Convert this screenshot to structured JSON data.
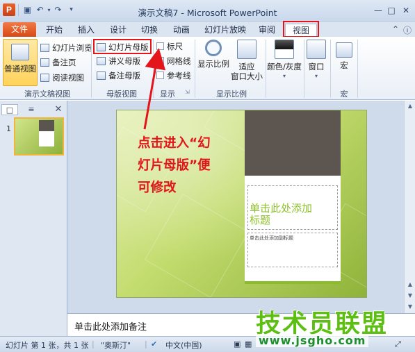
{
  "window": {
    "title": "演示文稿7 - Microsoft PowerPoint",
    "app_icon": "P"
  },
  "tabs": [
    "文件",
    "开始",
    "插入",
    "设计",
    "切换",
    "动画",
    "幻灯片放映",
    "审阅",
    "视图"
  ],
  "active_tab": "视图",
  "ribbon": {
    "presentation_views": {
      "label": "演示文稿视图",
      "normal": "普通视图",
      "sorter": "幻灯片浏览",
      "notes": "备注页",
      "reading": "阅读视图"
    },
    "master_views": {
      "label": "母版视图",
      "slide_master": "幻灯片母版",
      "handout_master": "讲义母版",
      "notes_master": "备注母版"
    },
    "show": {
      "label": "显示",
      "ruler": "标尺",
      "gridlines": "网格线",
      "guides": "参考线"
    },
    "zoom": {
      "label": "显示比例",
      "zoom": "显示比例",
      "fit_line1": "适应",
      "fit_line2": "窗口大小"
    },
    "color": {
      "label": "颜色/灰度"
    },
    "window": {
      "label": "窗口"
    },
    "macros": {
      "group_label": "宏",
      "label": "宏"
    }
  },
  "slide_panel": {
    "number": "1"
  },
  "annotation": {
    "line1": "点击进入“幻",
    "line2": "灯片母版”便",
    "line3": "可修改"
  },
  "slide": {
    "title_placeholder_line1": "单击此处添加",
    "title_placeholder_line2": "标题",
    "subtitle_placeholder": "单击此处添加副标题"
  },
  "notes": {
    "placeholder": "单击此处添加备注"
  },
  "status": {
    "slide_info": "幻灯片 第 1 张，共 1 张",
    "theme": "\"奥斯汀\"",
    "language": "中文(中国)"
  },
  "watermark": {
    "text": "技术员联盟",
    "url": "www.jsgho.com"
  },
  "colors": {
    "highlight_red": "#e3141a",
    "file_tab": "#d74a16",
    "slide_green": "#8fc02d",
    "watermark_green": "#5cbf12"
  }
}
